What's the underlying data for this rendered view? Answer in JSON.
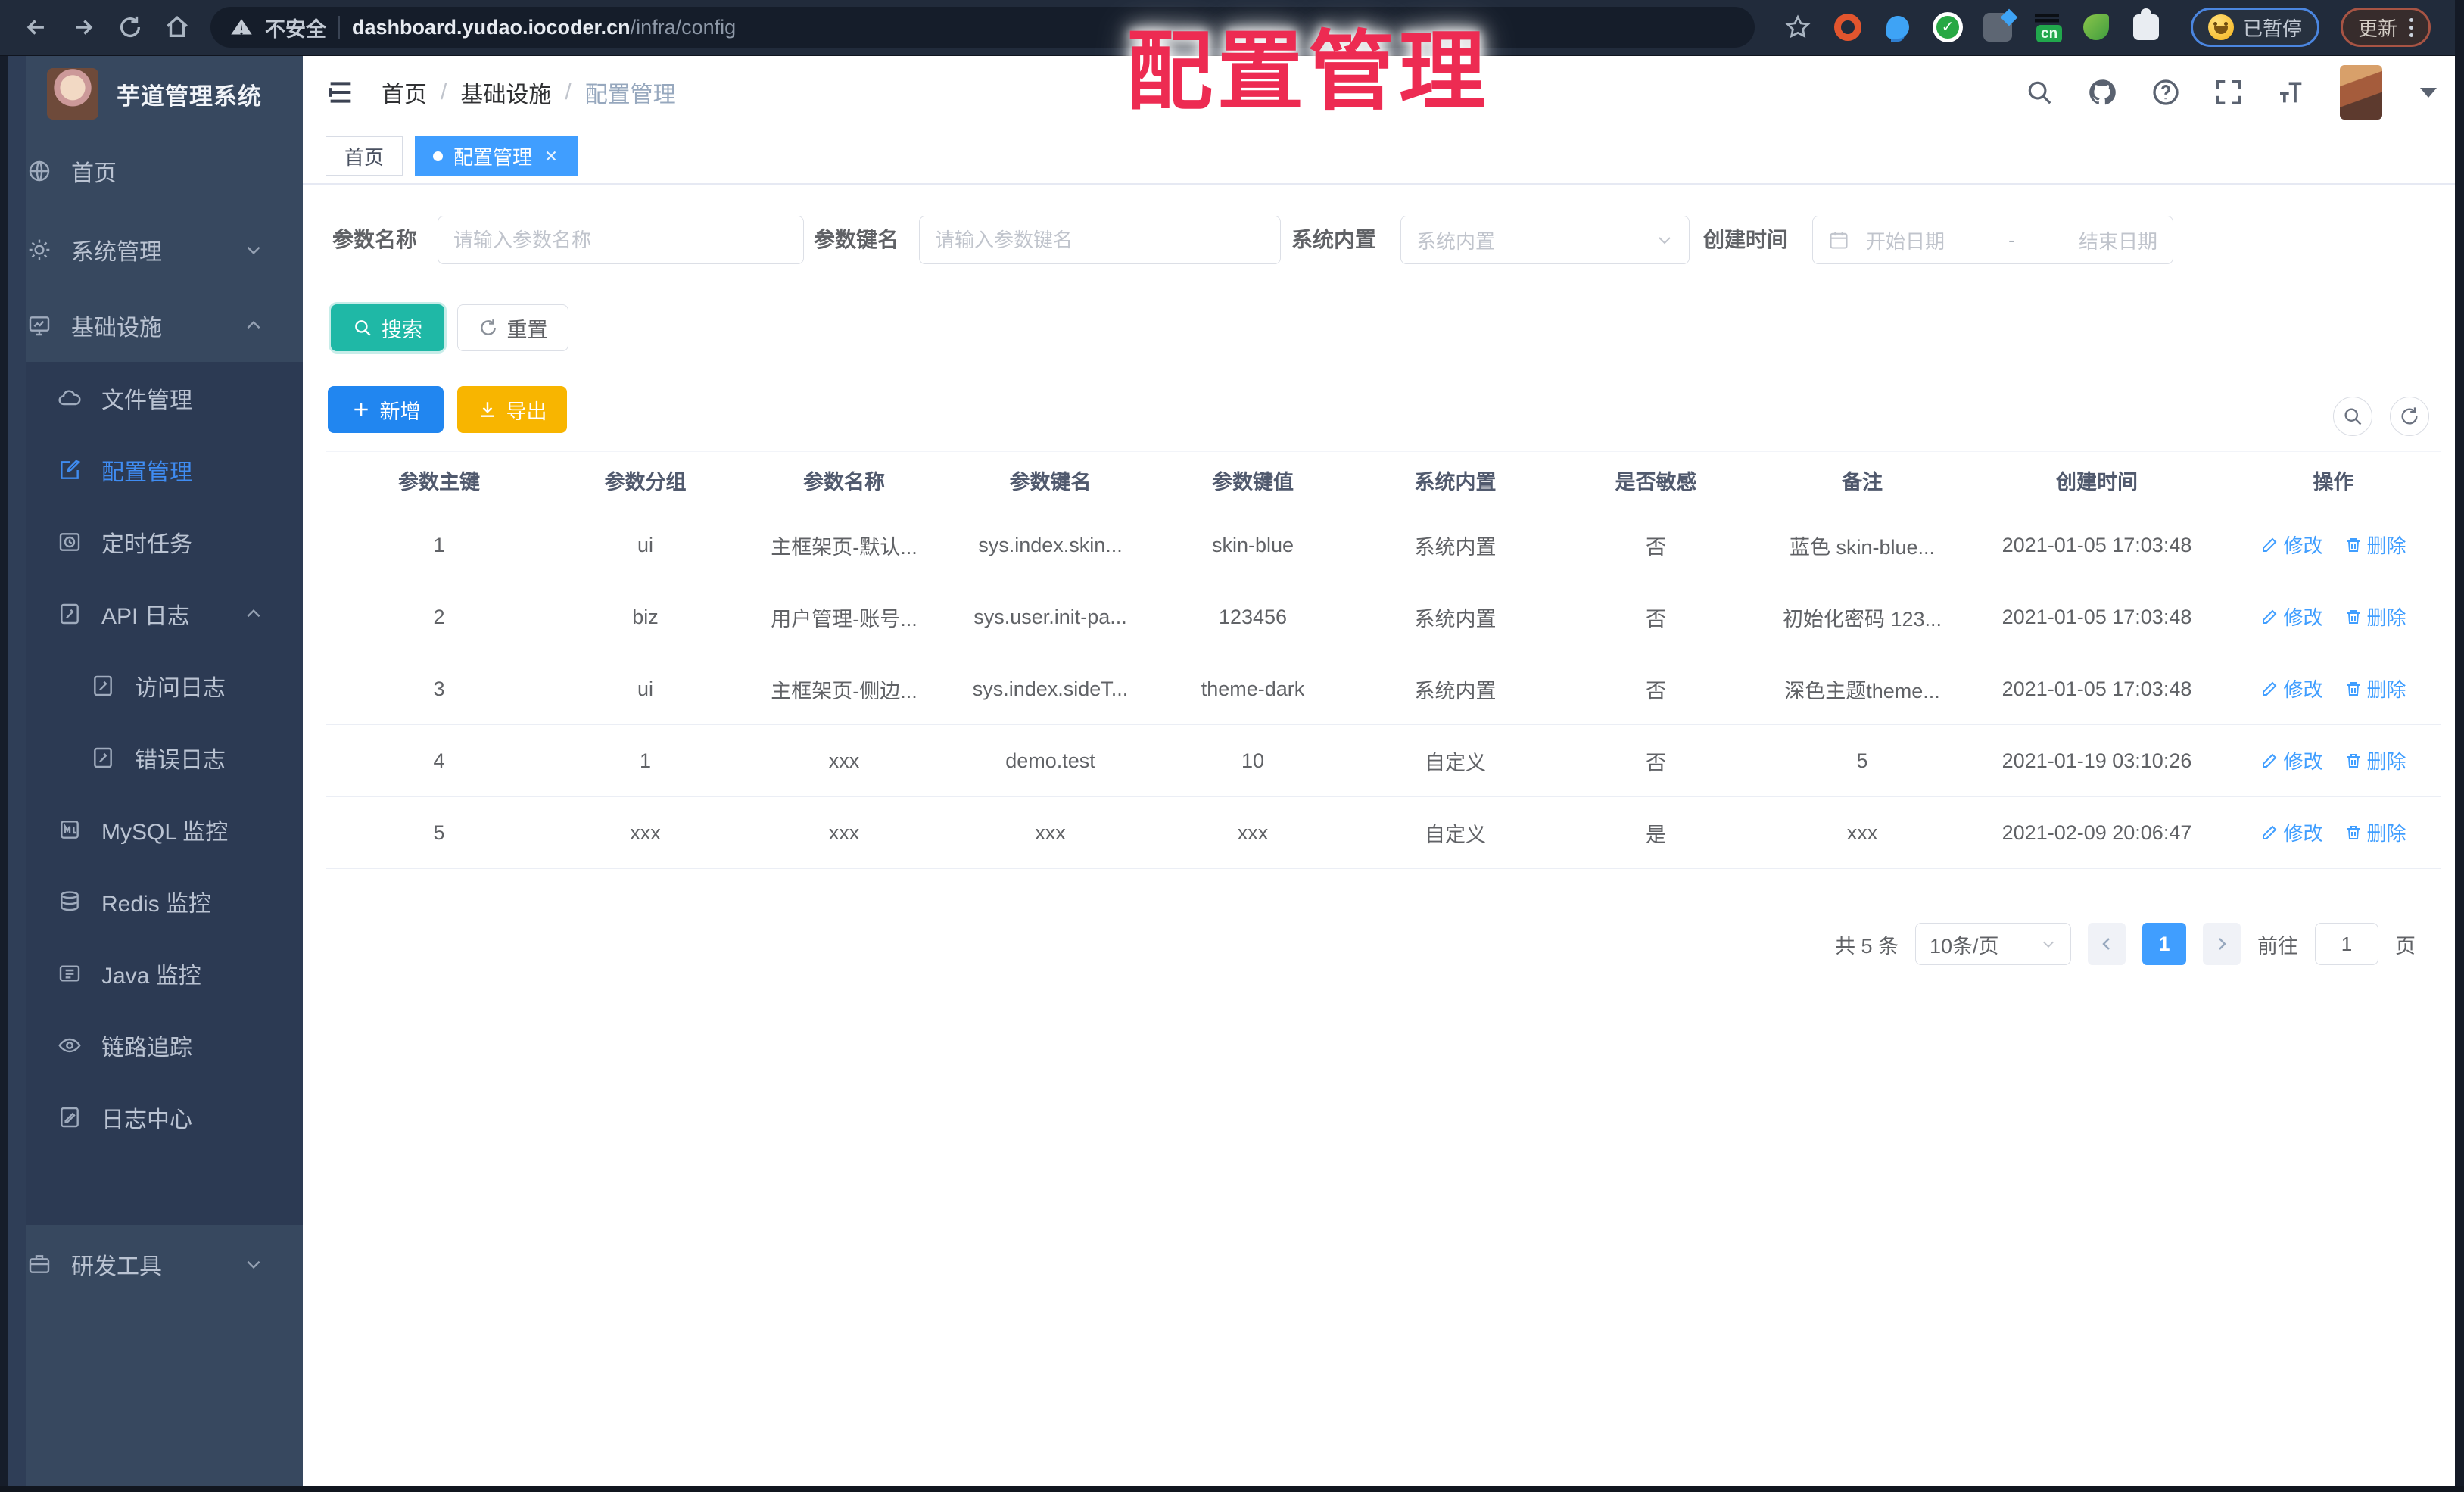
{
  "colors": {
    "accent": "#409eff",
    "teal": "#1fb8a6",
    "warning": "#f8b500",
    "overlay_red": "#ed2b52",
    "sidebar_bg": "#37485f",
    "chrome_bg": "#212b3b"
  },
  "browser": {
    "security_label": "不安全",
    "url_host": "dashboard.yudao.iocoder.cn",
    "url_path": "/infra/config",
    "ext_cn_badge": "cn",
    "paused_label": "已暂停",
    "update_label": "更新"
  },
  "overlay": {
    "title": "配置管理"
  },
  "sidebar": {
    "title": "芋道管理系统",
    "items": {
      "home": "首页",
      "system": "系统管理",
      "infra": "基础设施",
      "file": "文件管理",
      "config": "配置管理",
      "job": "定时任务",
      "api_log": "API 日志",
      "access_log": "访问日志",
      "error_log": "错误日志",
      "mysql": "MySQL 监控",
      "redis": "Redis 监控",
      "java": "Java 监控",
      "trace": "链路追踪",
      "log_center": "日志中心",
      "dev_tools": "研发工具"
    }
  },
  "header": {
    "breadcrumb": [
      "首页",
      "基础设施",
      "配置管理"
    ],
    "sep": "/"
  },
  "tabs": {
    "home": "首页",
    "current": "配置管理"
  },
  "filters": {
    "name_label": "参数名称",
    "name_placeholder": "请输入参数名称",
    "key_label": "参数键名",
    "key_placeholder": "请输入参数键名",
    "type_label": "系统内置",
    "type_placeholder": "系统内置",
    "date_label": "创建时间",
    "date_start": "开始日期",
    "date_sep": "-",
    "date_end": "结束日期"
  },
  "toolbar": {
    "search": "搜索",
    "reset": "重置",
    "add": "新增",
    "export": "导出"
  },
  "table": {
    "columns": [
      "参数主键",
      "参数分组",
      "参数名称",
      "参数键名",
      "参数键值",
      "系统内置",
      "是否敏感",
      "备注",
      "创建时间",
      "操作"
    ],
    "action_edit": "修改",
    "action_delete": "删除",
    "rows": [
      [
        "1",
        "ui",
        "主框架页-默认...",
        "sys.index.skin...",
        "skin-blue",
        "系统内置",
        "否",
        "蓝色 skin-blue...",
        "2021-01-05 17:03:48"
      ],
      [
        "2",
        "biz",
        "用户管理-账号...",
        "sys.user.init-pa...",
        "123456",
        "系统内置",
        "否",
        "初始化密码 123...",
        "2021-01-05 17:03:48"
      ],
      [
        "3",
        "ui",
        "主框架页-侧边...",
        "sys.index.sideT...",
        "theme-dark",
        "系统内置",
        "否",
        "深色主题theme...",
        "2021-01-05 17:03:48"
      ],
      [
        "4",
        "1",
        "xxx",
        "demo.test",
        "10",
        "自定义",
        "否",
        "5",
        "2021-01-19 03:10:26"
      ],
      [
        "5",
        "xxx",
        "xxx",
        "xxx",
        "xxx",
        "自定义",
        "是",
        "xxx",
        "2021-02-09 20:06:47"
      ]
    ]
  },
  "pagination": {
    "total": "共 5 条",
    "page_size": "10条/页",
    "page": "1",
    "goto_label": "前往",
    "goto_value": "1",
    "unit": "页"
  }
}
